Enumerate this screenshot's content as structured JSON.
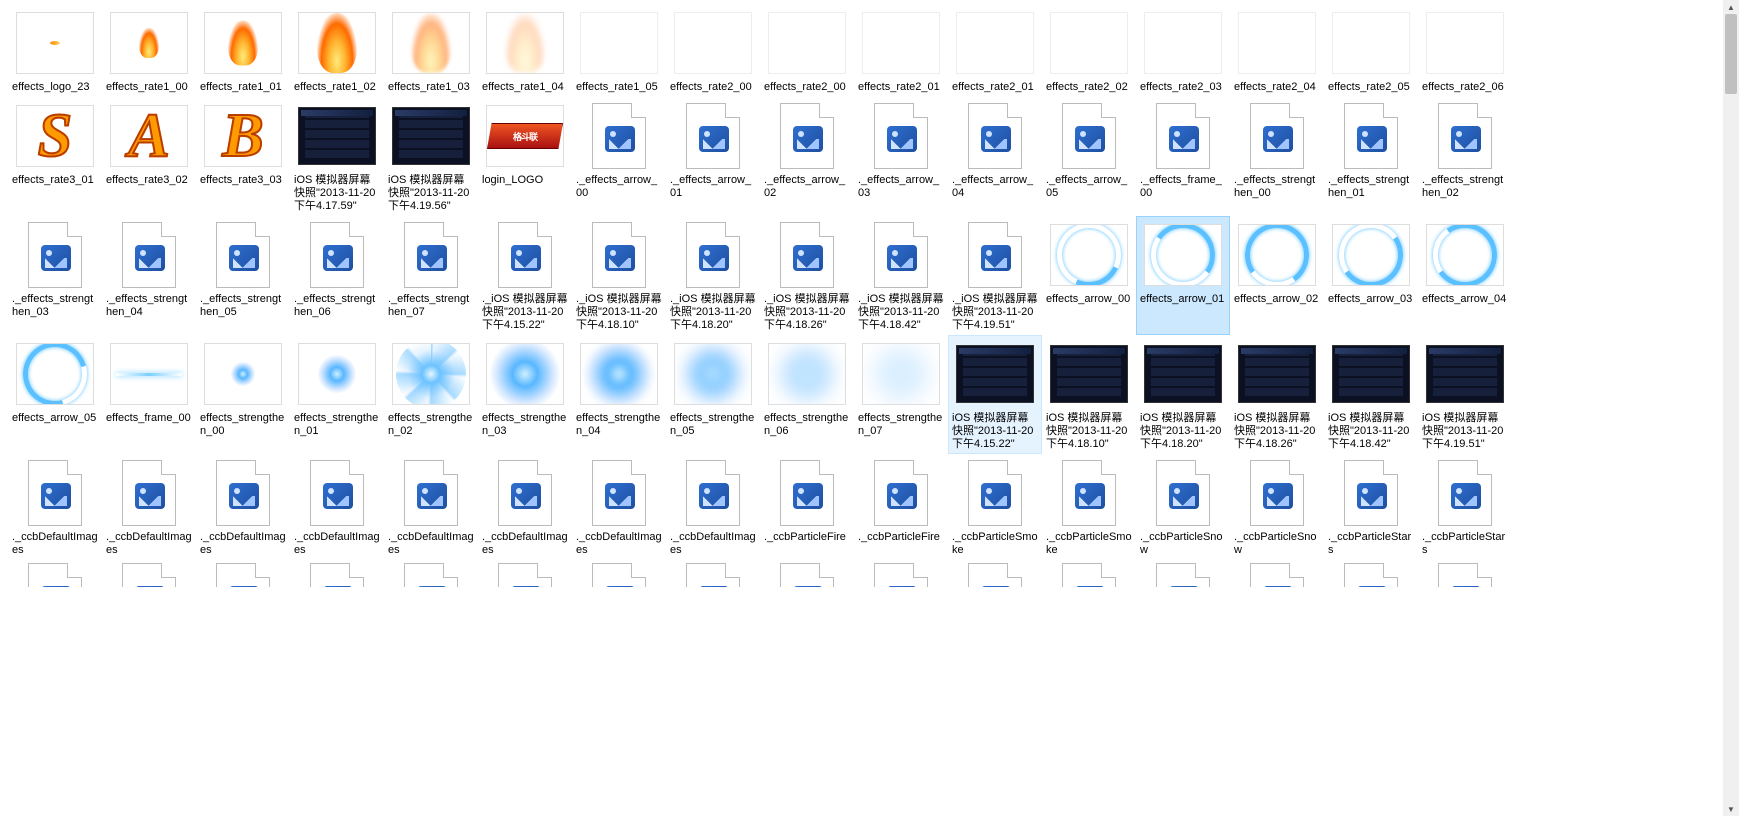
{
  "items": [
    {
      "label": "effects_logo_23",
      "kind": "ember"
    },
    {
      "label": "effects_rate1_00",
      "kind": "flame-sm"
    },
    {
      "label": "effects_rate1_01",
      "kind": "flame-md"
    },
    {
      "label": "effects_rate1_02",
      "kind": "flame"
    },
    {
      "label": "effects_rate1_03",
      "kind": "flame-fade"
    },
    {
      "label": "effects_rate1_04",
      "kind": "flame-fade2"
    },
    {
      "label": "effects_rate1_05",
      "kind": "blank"
    },
    {
      "label": "effects_rate2_00",
      "kind": "blank"
    },
    {
      "label": "effects_rate2_00",
      "kind": "blank"
    },
    {
      "label": "effects_rate2_01",
      "kind": "blank"
    },
    {
      "label": "effects_rate2_01",
      "kind": "blank"
    },
    {
      "label": "effects_rate2_02",
      "kind": "blank"
    },
    {
      "label": "effects_rate2_03",
      "kind": "blank"
    },
    {
      "label": "effects_rate2_04",
      "kind": "blank"
    },
    {
      "label": "effects_rate2_05",
      "kind": "blank"
    },
    {
      "label": "effects_rate2_06",
      "kind": "blank"
    },
    {
      "label": "effects_rate3_01",
      "kind": "letter-S"
    },
    {
      "label": "effects_rate3_02",
      "kind": "letter-A"
    },
    {
      "label": "effects_rate3_03",
      "kind": "letter-B"
    },
    {
      "label": "iOS 模拟器屏幕快照\"2013-11-20 下午4.17.59\"",
      "kind": "gameui"
    },
    {
      "label": "iOS 模拟器屏幕快照\"2013-11-20 下午4.19.56\"",
      "kind": "gameui"
    },
    {
      "label": "login_LOGO",
      "kind": "loginlogo"
    },
    {
      "label": "._effects_arrow_00",
      "kind": "generic"
    },
    {
      "label": "._effects_arrow_01",
      "kind": "generic"
    },
    {
      "label": "._effects_arrow_02",
      "kind": "generic"
    },
    {
      "label": "._effects_arrow_03",
      "kind": "generic"
    },
    {
      "label": "._effects_arrow_04",
      "kind": "generic"
    },
    {
      "label": "._effects_arrow_05",
      "kind": "generic"
    },
    {
      "label": "._effects_frame_00",
      "kind": "generic"
    },
    {
      "label": "._effects_strengthen_00",
      "kind": "generic"
    },
    {
      "label": "._effects_strengthen_01",
      "kind": "generic"
    },
    {
      "label": "._effects_strengthen_02",
      "kind": "generic"
    },
    {
      "label": "._effects_strengthen_03",
      "kind": "generic"
    },
    {
      "label": "._effects_strengthen_04",
      "kind": "generic"
    },
    {
      "label": "._effects_strengthen_05",
      "kind": "generic"
    },
    {
      "label": "._effects_strengthen_06",
      "kind": "generic"
    },
    {
      "label": "._effects_strengthen_07",
      "kind": "generic"
    },
    {
      "label": "._iOS 模拟器屏幕快照\"2013-11-20 下午4.15.22\"",
      "kind": "generic"
    },
    {
      "label": "._iOS 模拟器屏幕快照\"2013-11-20 下午4.18.10\"",
      "kind": "generic"
    },
    {
      "label": "._iOS 模拟器屏幕快照\"2013-11-20 下午4.18.20\"",
      "kind": "generic"
    },
    {
      "label": "._iOS 模拟器屏幕快照\"2013-11-20 下午4.18.26\"",
      "kind": "generic"
    },
    {
      "label": "._iOS 模拟器屏幕快照\"2013-11-20 下午4.18.42\"",
      "kind": "generic"
    },
    {
      "label": "._iOS 模拟器屏幕快照\"2013-11-20 下午4.19.51\"",
      "kind": "generic"
    },
    {
      "label": "effects_arrow_00",
      "kind": "arc-a0"
    },
    {
      "label": "effects_arrow_01",
      "kind": "arc-a1",
      "state": "selected"
    },
    {
      "label": "effects_arrow_02",
      "kind": "arc-a2"
    },
    {
      "label": "effects_arrow_03",
      "kind": "arc-a3"
    },
    {
      "label": "effects_arrow_04",
      "kind": "arc-a4"
    },
    {
      "label": "effects_arrow_05",
      "kind": "arc-a5"
    },
    {
      "label": "effects_frame_00",
      "kind": "line-frame"
    },
    {
      "label": "effects_strengthen_00",
      "kind": "burst-sm"
    },
    {
      "label": "effects_strengthen_01",
      "kind": "burst-md"
    },
    {
      "label": "effects_strengthen_02",
      "kind": "burst-spike"
    },
    {
      "label": "effects_strengthen_03",
      "kind": "burst"
    },
    {
      "label": "effects_strengthen_04",
      "kind": "burst-soft"
    },
    {
      "label": "effects_strengthen_05",
      "kind": "burst-softer"
    },
    {
      "label": "effects_strengthen_06",
      "kind": "burst-faint"
    },
    {
      "label": "effects_strengthen_07",
      "kind": "burst-faint2"
    },
    {
      "label": "iOS 模拟器屏幕快照\"2013-11-20 下午4.15.22\"",
      "kind": "gameui",
      "state": "hover"
    },
    {
      "label": "iOS 模拟器屏幕快照\"2013-11-20 下午4.18.10\"",
      "kind": "gameui"
    },
    {
      "label": "iOS 模拟器屏幕快照\"2013-11-20 下午4.18.20\"",
      "kind": "gameui"
    },
    {
      "label": "iOS 模拟器屏幕快照\"2013-11-20 下午4.18.26\"",
      "kind": "gameui"
    },
    {
      "label": "iOS 模拟器屏幕快照\"2013-11-20 下午4.18.42\"",
      "kind": "gameui"
    },
    {
      "label": "iOS 模拟器屏幕快照\"2013-11-20 下午4.19.51\"",
      "kind": "gameui"
    },
    {
      "label": "._ccbDefaultImages",
      "kind": "generic"
    },
    {
      "label": "._ccbDefaultImages",
      "kind": "generic"
    },
    {
      "label": "._ccbDefaultImages",
      "kind": "generic"
    },
    {
      "label": "._ccbDefaultImages",
      "kind": "generic"
    },
    {
      "label": "._ccbDefaultImages",
      "kind": "generic"
    },
    {
      "label": "._ccbDefaultImages",
      "kind": "generic"
    },
    {
      "label": "._ccbDefaultImages",
      "kind": "generic"
    },
    {
      "label": "._ccbDefaultImages",
      "kind": "generic"
    },
    {
      "label": "._ccbParticleFire",
      "kind": "generic"
    },
    {
      "label": "._ccbParticleFire",
      "kind": "generic"
    },
    {
      "label": "._ccbParticleSmoke",
      "kind": "generic"
    },
    {
      "label": "._ccbParticleSmoke",
      "kind": "generic"
    },
    {
      "label": "._ccbParticleSnow",
      "kind": "generic"
    },
    {
      "label": "._ccbParticleSnow",
      "kind": "generic"
    },
    {
      "label": "._ccbParticleStars",
      "kind": "generic"
    },
    {
      "label": "._ccbParticleStars",
      "kind": "generic"
    },
    {
      "label": "",
      "kind": "generic-partial"
    },
    {
      "label": "",
      "kind": "generic-partial"
    },
    {
      "label": "",
      "kind": "generic-partial"
    },
    {
      "label": "",
      "kind": "generic-partial"
    },
    {
      "label": "",
      "kind": "generic-partial"
    },
    {
      "label": "",
      "kind": "generic-partial"
    },
    {
      "label": "",
      "kind": "generic-partial"
    },
    {
      "label": "",
      "kind": "generic-partial"
    },
    {
      "label": "",
      "kind": "generic-partial"
    },
    {
      "label": "",
      "kind": "generic-partial"
    },
    {
      "label": "",
      "kind": "generic-partial"
    },
    {
      "label": "",
      "kind": "generic-partial"
    },
    {
      "label": "",
      "kind": "generic-partial"
    },
    {
      "label": "",
      "kind": "generic-partial"
    },
    {
      "label": "",
      "kind": "generic-partial"
    },
    {
      "label": "",
      "kind": "generic-partial"
    }
  ]
}
